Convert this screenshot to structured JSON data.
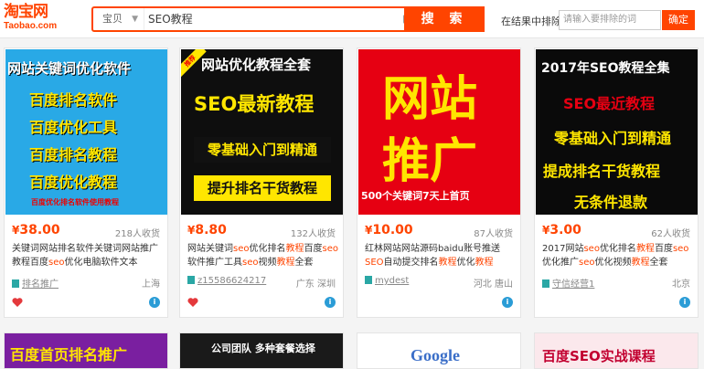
{
  "header": {
    "logo_cn": "淘宝网",
    "logo_en": "Taobao.com",
    "search_category": "宝贝",
    "search_query": "SEO教程",
    "search_button": "搜 索",
    "within_label": "在结果中排除",
    "within_placeholder": "请输入要排除的词",
    "within_button": "确定"
  },
  "cards": [
    {
      "img_lines": [
        "网站关键词优化软件",
        "百度排名软件",
        "百度优化工具",
        "百度排名教程",
        "百度优化教程",
        "百度优化排名软件使用教程"
      ],
      "price_symbol": "¥",
      "price": "38.00",
      "sold": "218人收货",
      "title_parts": [
        "关键词网站排名软件关键词网站推广教程百度",
        "seo",
        "优化电脑软件文本"
      ],
      "shop": "排名推广",
      "location": "上海"
    },
    {
      "img_lines": [
        "网站优化教程全套",
        "SEO最新教程",
        "零基础入门到精通",
        "提升排名干货教程",
        "推荐"
      ],
      "price_symbol": "¥",
      "price": "8.80",
      "sold": "132人收货",
      "title_parts": [
        "网站关键词",
        "seo",
        "优化排名",
        "教程",
        "百度",
        "seo",
        "软件推广工具",
        "seo",
        "视频",
        "教程",
        "全套"
      ],
      "shop": "z15586624217",
      "location": "广东 深圳"
    },
    {
      "img_lines": [
        "网站",
        "推广",
        "500个关键词7天上首页"
      ],
      "price_symbol": "¥",
      "price": "10.00",
      "sold": "87人收货",
      "title_parts": [
        "红林网站网站源码baidu账号推送",
        "SEO",
        "自动提交排名",
        "教程",
        "优化",
        "教程"
      ],
      "shop": "mydest",
      "location": "河北 唐山"
    },
    {
      "img_lines": [
        "2017年SEO教程全集",
        "SEO最近教程",
        "零基础入门到精通",
        "提成排名干货教程",
        "无条件退款"
      ],
      "price_symbol": "¥",
      "price": "3.00",
      "sold": "62人收货",
      "title_parts": [
        "2017网站",
        "seo",
        "优化排名",
        "教程",
        "百度",
        "seo",
        "优化推广",
        "seo",
        "优化视频",
        "教程",
        "全套"
      ],
      "shop": "守信经营1",
      "location": "北京"
    }
  ],
  "bottom_cards": [
    {
      "img_text": "百度首页排名推广"
    },
    {
      "img_text": "公司团队 多种套餐选择"
    },
    {
      "img_text": "Google"
    },
    {
      "img_text": "百度SEO实战课程"
    }
  ],
  "colors": {
    "accent": "#ff4400",
    "shop_icon": "#2aa7a5",
    "badge_blue": "#2a9cd6"
  }
}
